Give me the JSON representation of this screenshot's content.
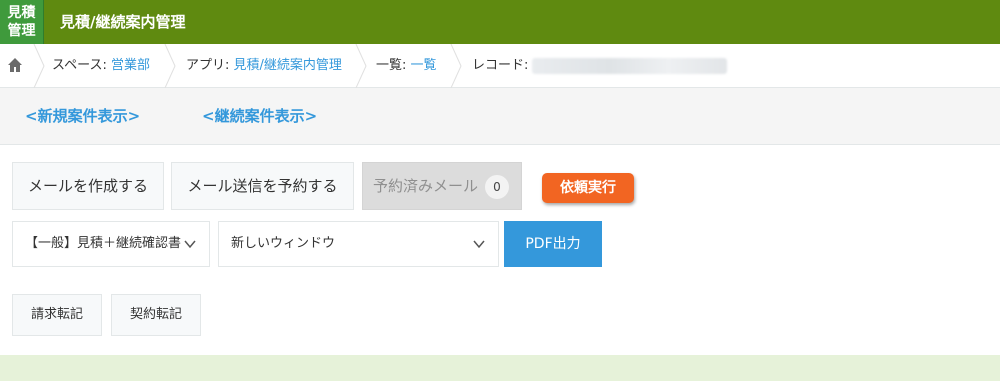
{
  "header": {
    "icon_line1": "見積",
    "icon_line2": "管理",
    "title": "見積/継続案内管理",
    "color": "#5f8a10"
  },
  "breadcrumb": {
    "home_icon": "home-icon",
    "space_label": "スペース: ",
    "space_value": "営業部",
    "app_label": "アプリ: ",
    "app_value": "見積/継続案内管理",
    "list_label": "一覧: ",
    "list_value": "一覧",
    "record_label": "レコード:"
  },
  "views": {
    "new_cases": "<新規案件表示>",
    "continuing_cases": "<継続案件表示>"
  },
  "actions": {
    "create_mail": "メールを作成する",
    "schedule_mail": "メール送信を予約する",
    "scheduled_mail": "予約済みメール",
    "scheduled_count": "0",
    "execute_request": "依頼実行",
    "template_select": "【一般】見積＋継続確認書",
    "window_select": "新しいウィンドウ",
    "pdf_output": "PDF出力",
    "billing_transfer": "請求転記",
    "contract_transfer": "契約転記"
  },
  "colors": {
    "accent_blue": "#3498db",
    "accent_orange": "#f26522",
    "app_icon_green": "#3f9a3c"
  }
}
